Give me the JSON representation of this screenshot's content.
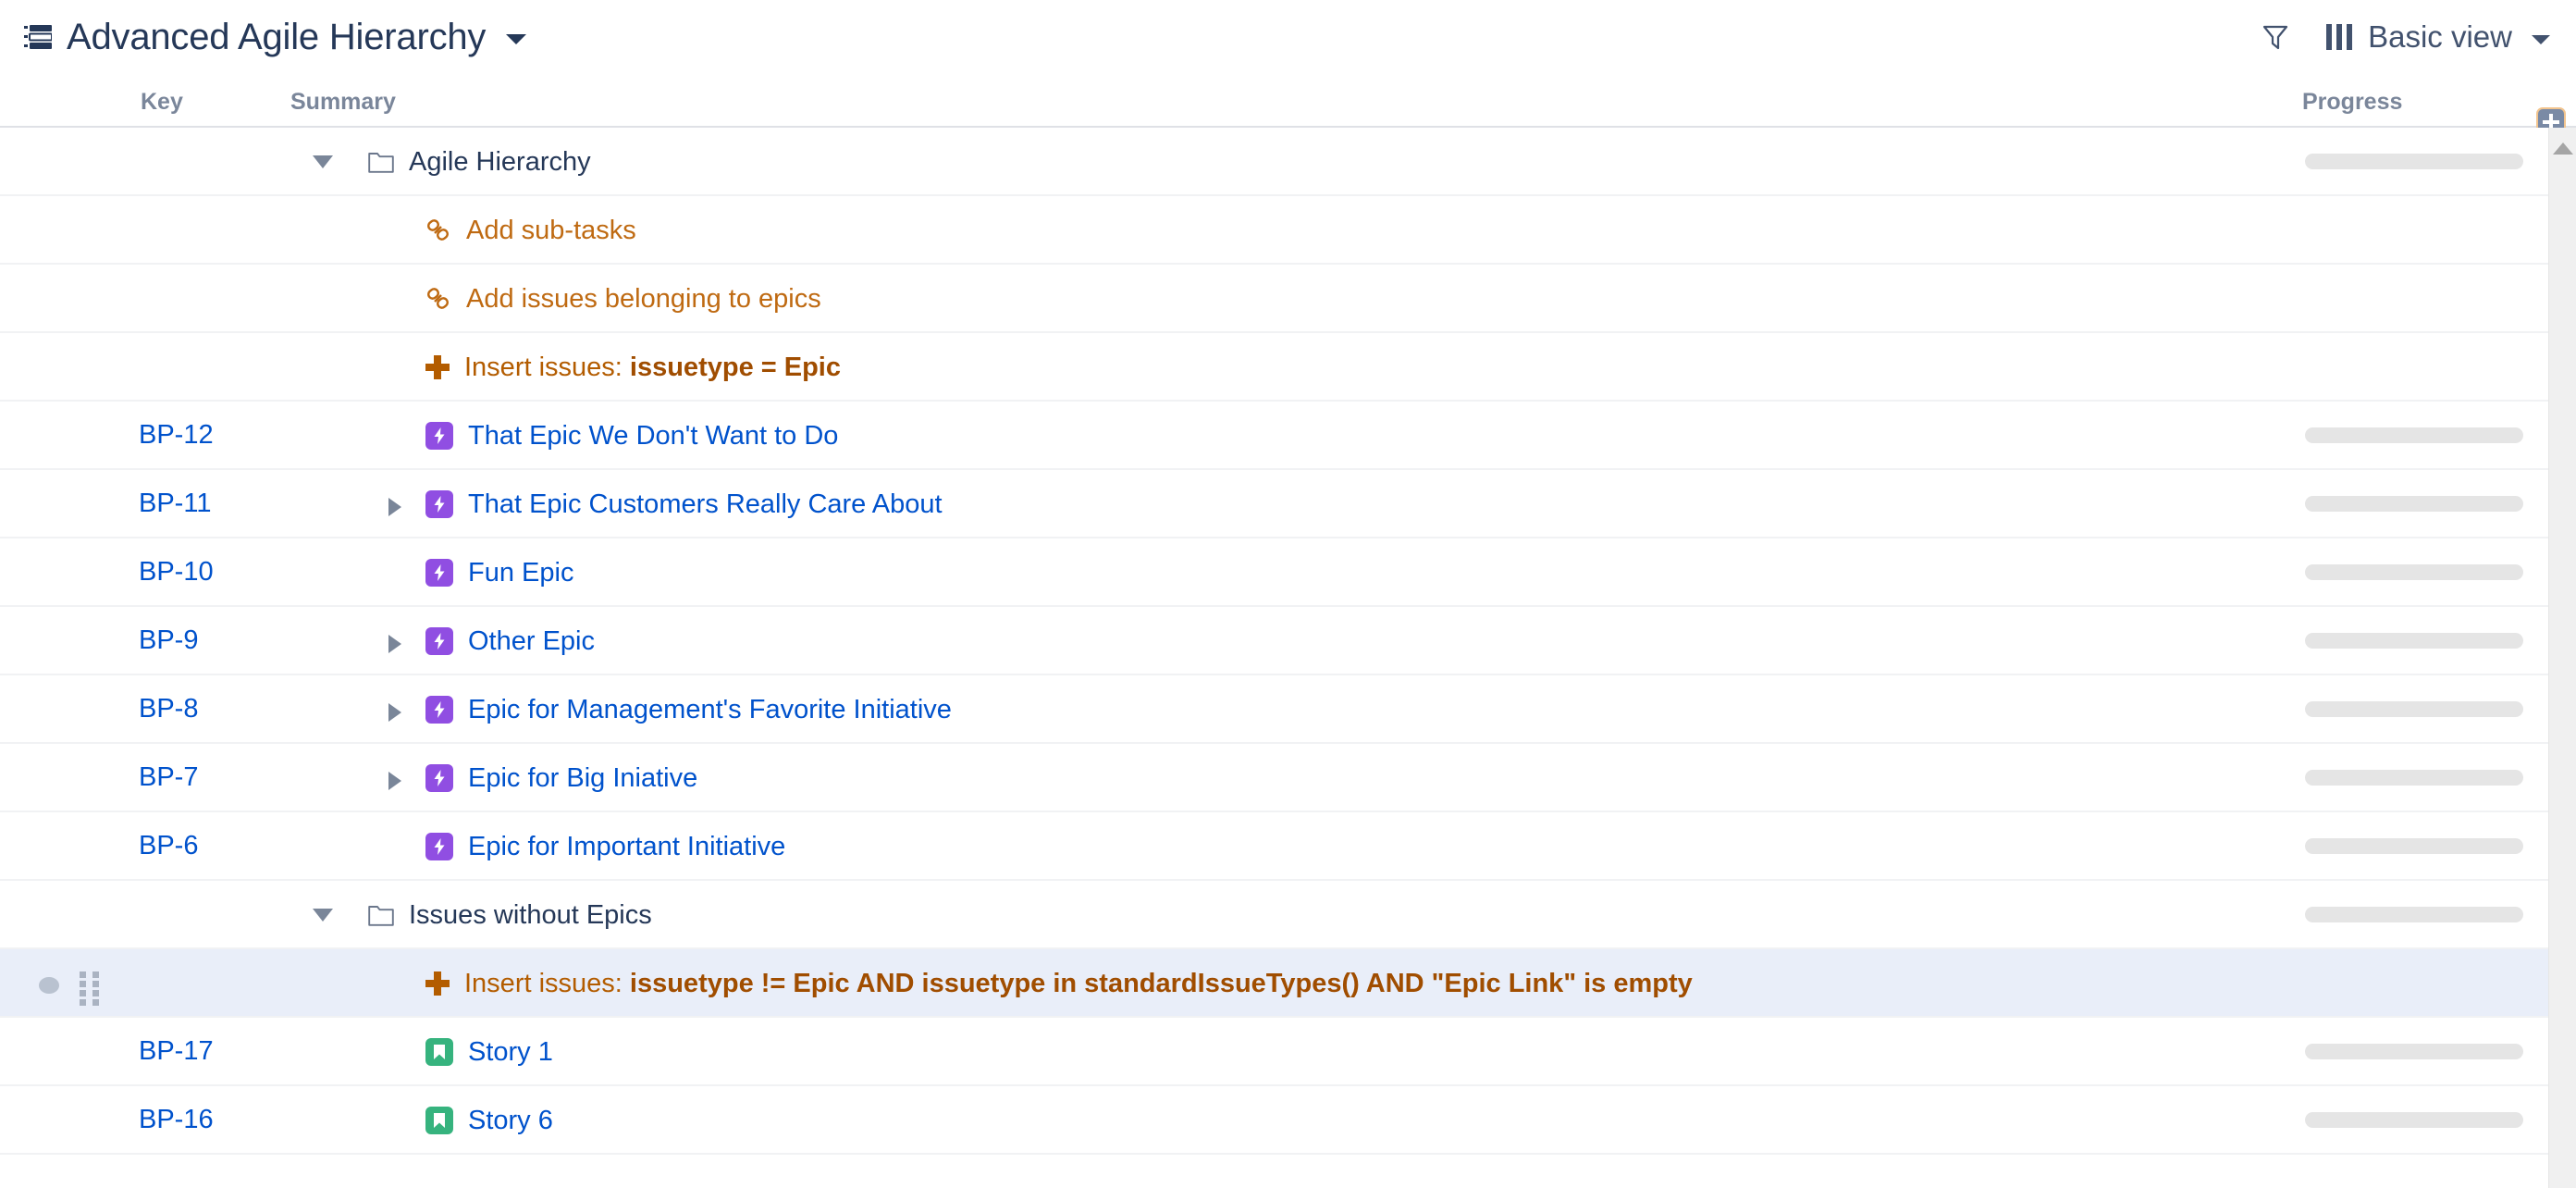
{
  "header": {
    "structure_icon": "structure-grid-icon",
    "title": "Advanced Agile Hierarchy",
    "title_caret": "chevron-down-icon",
    "filter_icon": "funnel-icon",
    "view_icon": "columns-icon",
    "view_label": "Basic view",
    "view_caret": "chevron-down-icon"
  },
  "columns": {
    "key": "Key",
    "summary": "Summary",
    "progress": "Progress",
    "add_column": "add-column-button"
  },
  "colors": {
    "link_blue": "#0052cc",
    "title_navy": "#253858",
    "header_gray": "#7a869a",
    "orange": "#b35c00",
    "epic_purple": "#904ee2",
    "story_green": "#36b37e",
    "selected_row": "#e9eef9",
    "progress_track": "#e5e5e5"
  },
  "rows": [
    {
      "kind": "folder",
      "key": "",
      "indent": 198,
      "expander": "expanded",
      "icon": "folder-icon",
      "summary": "Agile Hierarchy",
      "progress": true,
      "selected": false
    },
    {
      "kind": "generator-link",
      "key": "",
      "indent": 260,
      "expander": "",
      "icon": "link-icon",
      "summary": "Add sub-tasks",
      "progress": false,
      "selected": false
    },
    {
      "kind": "generator-link",
      "key": "",
      "indent": 260,
      "expander": "",
      "icon": "link-icon",
      "summary": "Add issues belonging to epics",
      "progress": false,
      "selected": false
    },
    {
      "kind": "generator-insert",
      "key": "",
      "indent": 260,
      "expander": "",
      "icon": "plus-icon",
      "summary_prefix": "Insert issues: ",
      "summary_query": "issuetype = Epic",
      "progress": false,
      "selected": false
    },
    {
      "kind": "issue",
      "key": "BP-12",
      "indent": 260,
      "expander": "",
      "icon": "epic-icon",
      "summary": "That Epic We Don't Want to Do",
      "progress": true,
      "selected": false
    },
    {
      "kind": "issue",
      "key": "BP-11",
      "indent": 260,
      "expander": "collapsed",
      "icon": "epic-icon",
      "summary": "That Epic Customers Really Care About",
      "progress": true,
      "selected": false
    },
    {
      "kind": "issue",
      "key": "BP-10",
      "indent": 260,
      "expander": "",
      "icon": "epic-icon",
      "summary": "Fun Epic",
      "progress": true,
      "selected": false
    },
    {
      "kind": "issue",
      "key": "BP-9",
      "indent": 260,
      "expander": "collapsed",
      "icon": "epic-icon",
      "summary": "Other Epic",
      "progress": true,
      "selected": false
    },
    {
      "kind": "issue",
      "key": "BP-8",
      "indent": 260,
      "expander": "collapsed",
      "icon": "epic-icon",
      "summary": "Epic for Management's Favorite Initiative",
      "progress": true,
      "selected": false
    },
    {
      "kind": "issue",
      "key": "BP-7",
      "indent": 260,
      "expander": "collapsed",
      "icon": "epic-icon",
      "summary": "Epic for Big Iniative",
      "progress": true,
      "selected": false
    },
    {
      "kind": "issue",
      "key": "BP-6",
      "indent": 260,
      "expander": "",
      "icon": "epic-icon",
      "summary": "Epic for Important Initiative",
      "progress": true,
      "selected": false
    },
    {
      "kind": "folder",
      "key": "",
      "indent": 198,
      "expander": "expanded",
      "icon": "folder-icon",
      "summary": "Issues without Epics",
      "progress": true,
      "selected": false
    },
    {
      "kind": "generator-insert",
      "key": "",
      "indent": 260,
      "expander": "",
      "icon": "plus-icon",
      "summary_prefix": "Insert issues: ",
      "summary_query": "issuetype != Epic AND issuetype in standardIssueTypes() AND \"Epic Link\" is empty",
      "progress": false,
      "selected": true,
      "row_dot": true,
      "drag_handle": true
    },
    {
      "kind": "issue",
      "key": "BP-17",
      "indent": 260,
      "expander": "",
      "icon": "story-icon",
      "summary": "Story 1",
      "progress": true,
      "selected": false
    },
    {
      "kind": "issue",
      "key": "BP-16",
      "indent": 260,
      "expander": "",
      "icon": "story-icon",
      "summary": "Story 6",
      "progress": true,
      "selected": false
    }
  ],
  "scrollbar": {
    "up_arrow": "scroll-up-arrow"
  }
}
